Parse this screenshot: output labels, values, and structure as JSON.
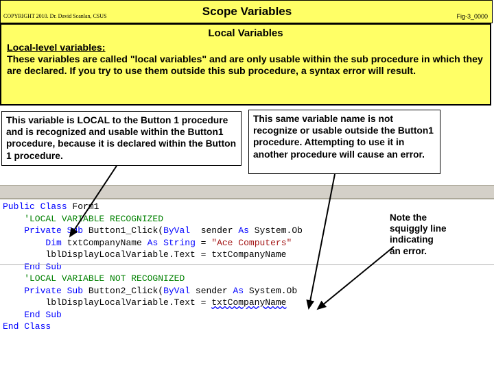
{
  "header": {
    "copyright": "COPYRIGHT 2010. Dr. David Scanlan, CSUS",
    "title": "Scope Variables",
    "figure": "Fig-3_0000"
  },
  "panel": {
    "subheader": "Local Variables",
    "term": "Local-level variables:",
    "body": "These variables are called \"local variables\" and are only usable within the sub procedure in which they are declared.  If you try to use them outside this sub procedure, a syntax error will result."
  },
  "calloutLeft": "This variable is LOCAL to the Button 1 procedure and is recognized and usable within the Button1 procedure, because it is declared  within the Button 1 procedure.",
  "calloutRight": "This same variable name is not recognize or usable outside the Button1 procedure.  Attempting to  use it in another procedure will cause an error.",
  "note": {
    "l1": "Note the",
    "l2": "squiggly line",
    "l3": "indicating",
    "l4": "an error."
  },
  "code": {
    "l1a": "Public",
    "l1b": " Class",
    "l1c": " Form1",
    "l2": "    'LOCAL VARIABLE RECOGNIZED",
    "l3a": "    Private",
    "l3b": " Sub",
    "l3c": " Button1_Click(",
    "l3d": "ByVal",
    "l3e": "  sender ",
    "l3f": "As",
    "l3g": " System.Ob",
    "l4a": "        Dim",
    "l4b": " txtCompanyName ",
    "l4c": "As",
    "l4d": " String",
    "l4e": " = ",
    "l4f": "\"Ace Computers\"",
    "l5": "        lblDisplayLocalVariable.Text = txtCompanyName",
    "l6": "    End Sub",
    "l7": "    'LOCAL VARIABLE NOT RECOGNIZED",
    "l8a": "    Private",
    "l8b": " Sub",
    "l8c": " Button2_Click(",
    "l8d": "ByVal",
    "l8e": " sender ",
    "l8f": "As",
    "l8g": " System.Ob",
    "l9a": "        lblDisplayLocalVariable.Text = ",
    "l9b": "txtCompanyName",
    "l10": "    End Sub",
    "l11a": "End",
    "l11b": " Class"
  }
}
